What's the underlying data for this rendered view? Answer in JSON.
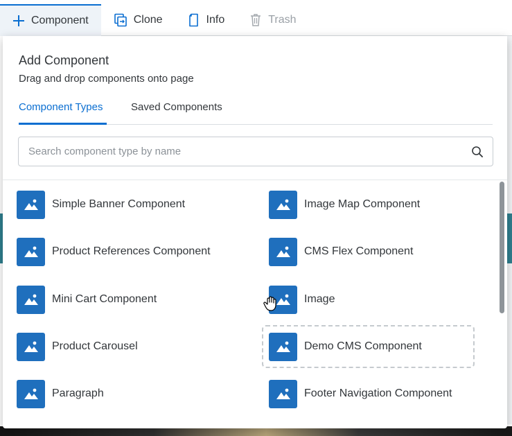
{
  "toolbar": {
    "component_label": "Component",
    "clone_label": "Clone",
    "info_label": "Info",
    "trash_label": "Trash"
  },
  "panel": {
    "title": "Add Component",
    "subtitle": "Drag and drop components onto page",
    "tabs": [
      {
        "label": "Component Types",
        "active": true
      },
      {
        "label": "Saved Components",
        "active": false
      }
    ],
    "search_placeholder": "Search component type by name"
  },
  "components": [
    "Simple Banner Component",
    "Image Map Component",
    "Product References Component",
    "CMS Flex Component",
    "Mini Cart Component",
    "Image",
    "Product Carousel",
    "Demo CMS Component",
    "Paragraph",
    "Footer Navigation Component"
  ],
  "icons": {
    "component": "image-placeholder-icon",
    "add": "plus-icon",
    "clone": "clone-icon",
    "info": "info-doc-icon",
    "trash": "trash-icon",
    "search": "search-icon",
    "cursor": "grab-hand-icon"
  },
  "colors": {
    "accent": "#0a6ed1",
    "tile": "#1f6fbd",
    "text": "#32363a",
    "disabled": "#9aa0a6"
  }
}
